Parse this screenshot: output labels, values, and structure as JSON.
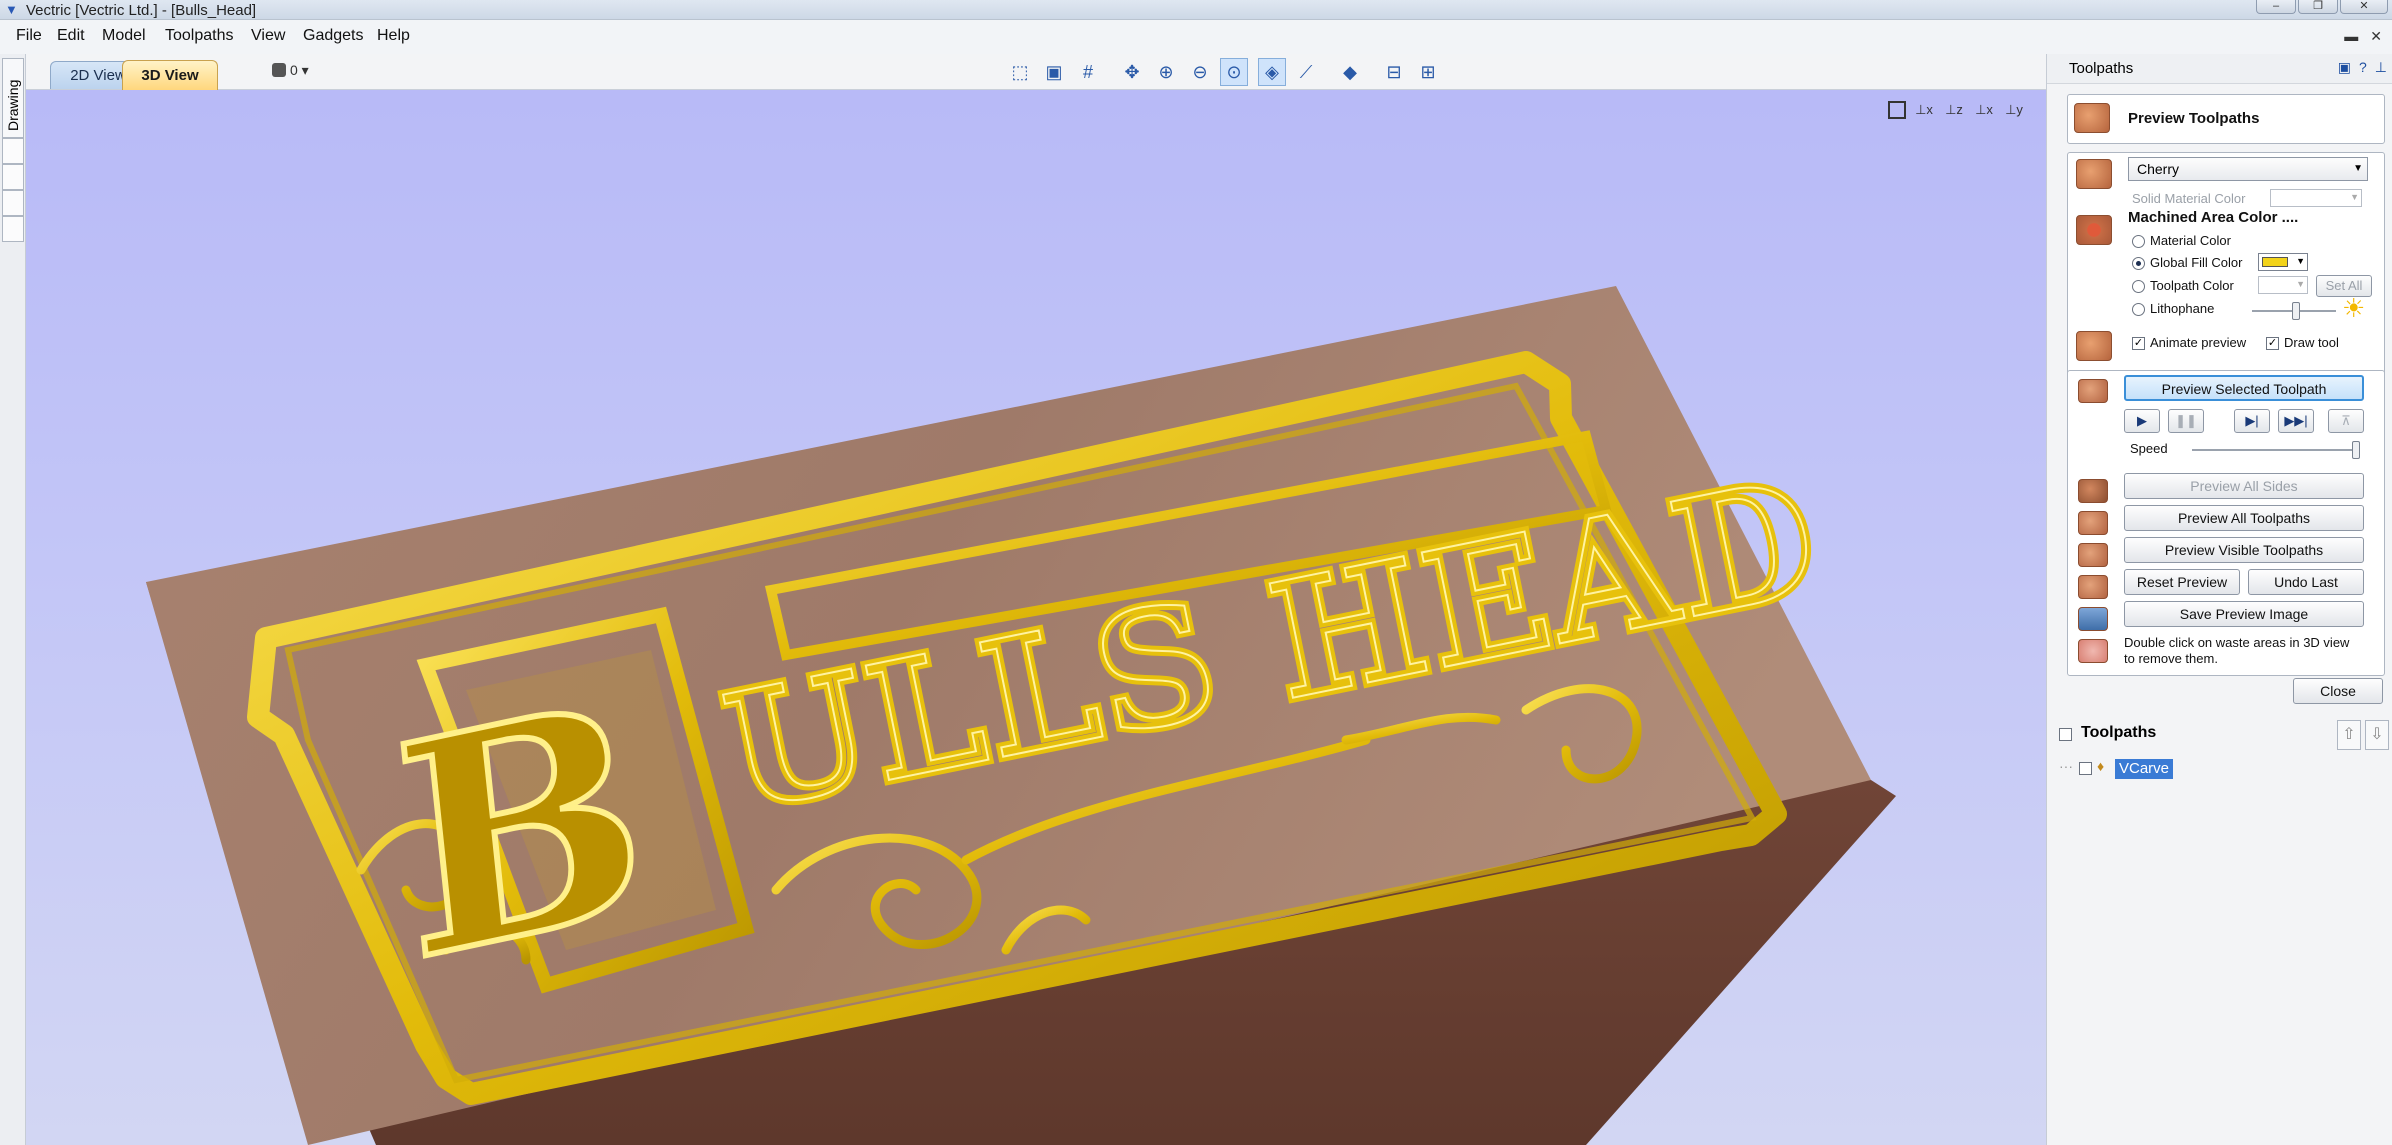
{
  "window": {
    "title": "Vectric [Vectric Ltd.] - [Bulls_Head]"
  },
  "menu": [
    "File",
    "Edit",
    "Model",
    "Toolpaths",
    "View",
    "Gadgets",
    "Help"
  ],
  "left_strip": {
    "tab_label": "Drawing"
  },
  "view_tabs": {
    "tab_2d": "2D View",
    "tab_3d": "3D View",
    "layer_value": "0"
  },
  "panel": {
    "header_title": "Toolpaths",
    "preview_title": "Preview Toolpaths",
    "material": {
      "selected": "Cherry",
      "solid_color_label": "Solid Material Color"
    },
    "machined": {
      "heading": "Machined Area Color ....",
      "options": [
        "Material Color",
        "Global Fill Color",
        "Toolpath Color",
        "Lithophane"
      ],
      "selected_index": 1,
      "global_fill_color": "#f2d31a",
      "set_all_label": "Set All"
    },
    "animate_preview_label": "Animate preview",
    "animate_preview_checked": true,
    "draw_tool_label": "Draw tool",
    "draw_tool_checked": true,
    "buttons": {
      "preview_selected": "Preview Selected Toolpath",
      "speed_label": "Speed",
      "speed_level": 1.0,
      "preview_all_sides": "Preview All Sides",
      "preview_all_toolpaths": "Preview All Toolpaths",
      "preview_visible": "Preview Visible Toolpaths",
      "reset_preview": "Reset Preview",
      "undo_last": "Undo Last",
      "save_preview_image": "Save Preview Image",
      "close": "Close"
    },
    "hint": [
      "Double click on waste areas in 3D view",
      "to remove them."
    ],
    "toolpaths_list": {
      "heading": "Toolpaths",
      "items": [
        "VCarve"
      ]
    }
  },
  "sign": {
    "title_top": "ULLS HEAD",
    "initial": "B",
    "wood_color": "#a47f6e",
    "carve_color": "#e8c20d"
  }
}
